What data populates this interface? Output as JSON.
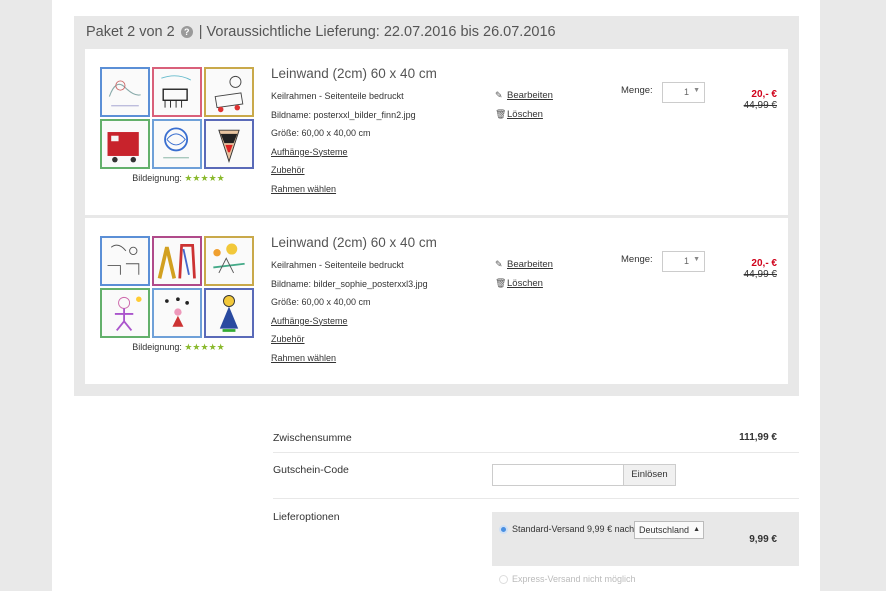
{
  "paket": {
    "title_prefix": "Paket 2 von 2",
    "help_glyph": "?",
    "title_suffix": "| Voraussichtliche Lieferung: 22.07.2016 bis 26.07.2016"
  },
  "items": [
    {
      "title": "Leinwand (2cm) 60 x 40 cm",
      "frame": "Keilrahmen - Seitenteile bedruckt",
      "bildname": "Bildname: posterxxl_bilder_finn2.jpg",
      "groesse": "Größe: 60,00 x 40,00 cm",
      "link_aufhaenge": "Aufhänge-Systeme",
      "link_zubehoer": "Zubehör",
      "link_rahmen": "Rahmen wählen",
      "bildeignung_label": "Bildeignung:",
      "stars": "★★★★★",
      "edit_label": "Bearbeiten",
      "delete_label": "Löschen",
      "menge_label": "Menge:",
      "qty": "1",
      "price_new": "20,- €",
      "price_old": "44,99 €",
      "thumb_colors": [
        "#5b8fd6",
        "#d9607a",
        "#c9a94a",
        "#63b06b",
        "#6fa0d8",
        "#5a6ab8"
      ]
    },
    {
      "title": "Leinwand (2cm) 60 x 40 cm",
      "frame": "Keilrahmen - Seitenteile bedruckt",
      "bildname": "Bildname: bilder_sophie_posterxxl3.jpg",
      "groesse": "Größe: 60,00 x 40,00 cm",
      "link_aufhaenge": "Aufhänge-Systeme",
      "link_zubehoer": "Zubehör",
      "link_rahmen": "Rahmen wählen",
      "bildeignung_label": "Bildeignung:",
      "stars": "★★★★★",
      "edit_label": "Bearbeiten",
      "delete_label": "Löschen",
      "menge_label": "Menge:",
      "qty": "1",
      "price_new": "20,- €",
      "price_old": "44,99 €",
      "thumb_colors": [
        "#5b8fd6",
        "#b04a8a",
        "#c9a94a",
        "#63b06b",
        "#6fa0d8",
        "#5a6ab8"
      ]
    }
  ],
  "summary": {
    "zwischensumme_label": "Zwischensumme",
    "zwischensumme_value": "111,99 €",
    "gutschein_label": "Gutschein-Code",
    "gutschein_placeholder": "",
    "einloesen_label": "Einlösen",
    "liefer_label": "Lieferoptionen",
    "standard_label": "Standard-Versand 9,99 € nach",
    "country": "Deutschland",
    "standard_price": "9,99 €",
    "express_label": "Express-Versand nicht möglich"
  },
  "colors": {
    "price_red": "#d0021b",
    "star_green": "#8ab92d",
    "radio_blue": "#4a90e2"
  }
}
